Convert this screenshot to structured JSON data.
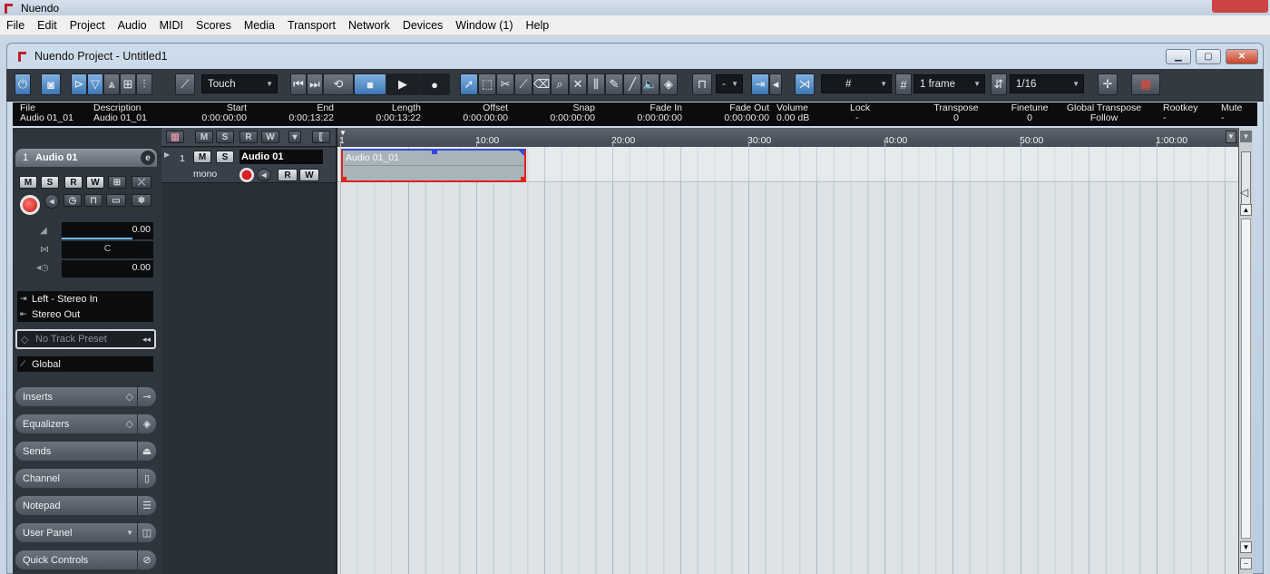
{
  "app": {
    "title": "Nuendo"
  },
  "menu": [
    "File",
    "Edit",
    "Project",
    "Audio",
    "MIDI",
    "Scores",
    "Media",
    "Transport",
    "Network",
    "Devices",
    "Window (1)",
    "Help"
  ],
  "project": {
    "title": "Nuendo Project - Untitled1"
  },
  "toolbar": {
    "automation_mode": "Touch",
    "snap_value": "-",
    "quantize_grid": "1 frame",
    "quantize_value": "1/16"
  },
  "infoline": {
    "columns": [
      {
        "h": "File",
        "v": "Audio 01_01"
      },
      {
        "h": "Description",
        "v": "Audio 01_01"
      },
      {
        "h": "Start",
        "v": "0:00:00:00"
      },
      {
        "h": "End",
        "v": "0:00:13:22"
      },
      {
        "h": "Length",
        "v": "0:00:13:22"
      },
      {
        "h": "Offset",
        "v": "0:00:00:00"
      },
      {
        "h": "Snap",
        "v": "0:00:00:00"
      },
      {
        "h": "Fade In",
        "v": "0:00:00:00"
      },
      {
        "h": "Fade Out",
        "v": "0:00:00:00"
      },
      {
        "h": "Volume",
        "v": "0.00 dB"
      },
      {
        "h": "Lock",
        "v": "-"
      },
      {
        "h": "Transpose",
        "v": "0"
      },
      {
        "h": "Finetune",
        "v": "0"
      },
      {
        "h": "Global Transpose",
        "v": "Follow"
      },
      {
        "h": "Rootkey",
        "v": "-"
      },
      {
        "h": "Mute",
        "v": "-"
      }
    ]
  },
  "inspector": {
    "track_number": "1",
    "track_name": "Audio 01",
    "buttons": {
      "mute": "M",
      "solo": "S",
      "read": "R",
      "write": "W"
    },
    "volume": "0.00",
    "pan": "C",
    "delay": "0.00",
    "input_routing": "Left - Stereo In",
    "output_routing": "Stereo Out",
    "track_preset": "No Track Preset",
    "automation_scope": "Global",
    "sections": [
      "Inserts",
      "Equalizers",
      "Sends",
      "Channel",
      "Notepad",
      "User Panel",
      "Quick Controls"
    ]
  },
  "tracklist": {
    "track": {
      "number": "1",
      "name": "Audio 01",
      "channel_mode": "mono",
      "mute": "M",
      "solo": "S",
      "read": "R",
      "write": "W"
    }
  },
  "ruler": {
    "ticks": [
      "1",
      "10:00",
      "20:00",
      "30:00",
      "40:00",
      "50:00",
      "1:00:00"
    ]
  },
  "events": [
    {
      "name": "Audio 01_01"
    }
  ]
}
